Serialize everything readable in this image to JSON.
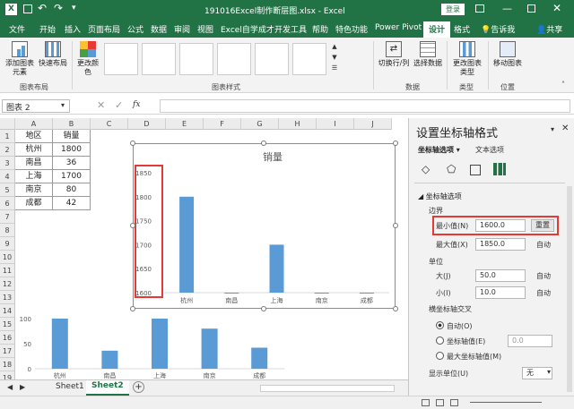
{
  "window": {
    "filename": "191016Excel制作断层图.xlsx - Excel",
    "login_label": "登录"
  },
  "tabs": [
    "文件",
    "开始",
    "插入",
    "页面布局",
    "公式",
    "数据",
    "审阅",
    "视图",
    "Excel自学成才",
    "开发工具",
    "帮助",
    "特色功能",
    "Power Pivot",
    "设计",
    "格式"
  ],
  "tabs_selected": "设计",
  "tell_me": "告诉我",
  "share": "共享",
  "ribbon": {
    "add_element": "添加图表元素",
    "quick_layout": "快速布局",
    "layout_group": "图表布局",
    "change_colors": "更改颜色",
    "styles_group": "图表样式",
    "switch_row_col": "切换行/列",
    "select_data": "选择数据",
    "data_group": "数据",
    "change_type": "更改图表类型",
    "type_group": "类型",
    "move_chart": "移动图表",
    "location_group": "位置"
  },
  "formula_bar": {
    "name_box": "图表 2",
    "fx": "fx",
    "formula": ""
  },
  "columns": [
    "A",
    "B",
    "C",
    "D",
    "E",
    "F",
    "G",
    "H",
    "I",
    "J"
  ],
  "rows": [
    "1",
    "2",
    "3",
    "4",
    "5",
    "6",
    "7",
    "8",
    "9",
    "10",
    "11",
    "12",
    "13",
    "14",
    "15",
    "16",
    "17",
    "18",
    "19"
  ],
  "table": {
    "header": [
      "地区",
      "销量"
    ],
    "rows": [
      [
        "杭州",
        "1800"
      ],
      [
        "南昌",
        "36"
      ],
      [
        "上海",
        "1700"
      ],
      [
        "南京",
        "80"
      ],
      [
        "成都",
        "42"
      ]
    ]
  },
  "chart_data": [
    {
      "type": "bar",
      "title": "销量",
      "categories": [
        "杭州",
        "南昌",
        "上海",
        "南京",
        "成都"
      ],
      "values": [
        1800,
        36,
        1700,
        80,
        42
      ],
      "ylim": [
        1600,
        1850
      ],
      "yticks": [
        "1600",
        "1650",
        "1700",
        "1750",
        "1800",
        "1850"
      ],
      "color": "#5b9bd5",
      "grid": false
    },
    {
      "type": "bar",
      "title": "",
      "categories": [
        "杭州",
        "南昌",
        "上海",
        "南京",
        "成都"
      ],
      "values": [
        100,
        36,
        100,
        80,
        42
      ],
      "ylim": [
        0,
        100
      ],
      "yticks": [
        "0",
        "50",
        "100"
      ],
      "color": "#5b9bd5",
      "grid": false
    }
  ],
  "sheets": [
    "Sheet1",
    "Sheet2"
  ],
  "active_sheet": "Sheet2",
  "pane": {
    "title": "设置坐标轴格式",
    "tab_axis": "坐标轴选项",
    "tab_text": "文本选项",
    "section": "坐标轴选项",
    "bounds_label": "边界",
    "min_label": "最小值(N)",
    "min_value": "1600.0",
    "reset_label": "重置",
    "max_label": "最大值(X)",
    "max_value": "1850.0",
    "auto_label": "自动",
    "unit_label": "单位",
    "major_label": "大(J)",
    "major_value": "50.0",
    "minor_label": "小(I)",
    "minor_value": "10.0",
    "cross_label": "横坐标轴交叉",
    "opt_auto": "自动(O)",
    "opt_value": "坐标轴值(E)",
    "opt_value_input": "0.0",
    "opt_max": "最大坐标轴值(M)",
    "display_unit_label": "显示单位(U)",
    "display_unit_value": "无"
  },
  "accent": "#217346",
  "highlight": "#e53935"
}
